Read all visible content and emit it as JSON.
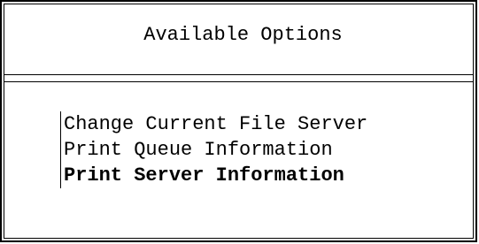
{
  "menu": {
    "title": "Available Options",
    "items": [
      {
        "label": "Change Current File Server",
        "selected": false
      },
      {
        "label": "Print Queue Information",
        "selected": false
      },
      {
        "label": "Print Server Information",
        "selected": true
      }
    ]
  },
  "colors": {
    "background": "#ffffff",
    "foreground": "#000000"
  }
}
